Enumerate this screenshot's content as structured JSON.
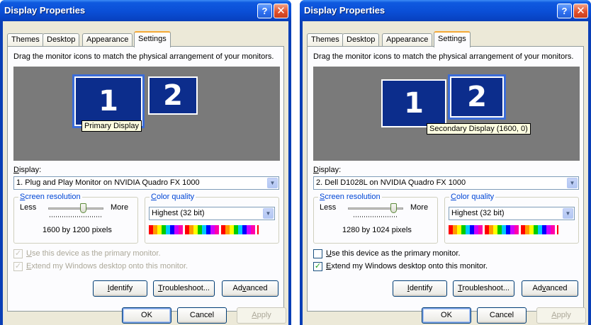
{
  "windows": [
    {
      "title": "Display Properties",
      "tabs": [
        "Themes",
        "Desktop",
        "Appearance",
        "Settings"
      ],
      "active_tab": "Settings",
      "instruction": "Drag the monitor icons to match the physical arrangement of your monitors.",
      "monitors": [
        {
          "number": "1",
          "selected": true
        },
        {
          "number": "2",
          "selected": false
        }
      ],
      "monitor_tooltip": "Primary Display",
      "display_label": "Display:",
      "display_value": "1. Plug and Play Monitor on NVIDIA Quadro FX 1000",
      "screen_resolution_label": "Screen resolution",
      "less_label": "Less",
      "more_label": "More",
      "resolution_value": "1600 by 1200 pixels",
      "color_quality_label": "Color quality",
      "color_quality_value": "Highest (32 bit)",
      "checkbox_primary": {
        "label": "Use this device as the primary monitor.",
        "checked": true,
        "disabled": true
      },
      "checkbox_extend": {
        "label": "Extend my Windows desktop onto this monitor.",
        "checked": true,
        "disabled": true
      },
      "buttons": {
        "identify": "Identify",
        "troubleshoot": "Troubleshoot...",
        "advanced": "Advanced"
      },
      "footer": {
        "ok": "OK",
        "cancel": "Cancel",
        "apply": "Apply"
      }
    },
    {
      "title": "Display Properties",
      "tabs": [
        "Themes",
        "Desktop",
        "Appearance",
        "Settings"
      ],
      "active_tab": "Settings",
      "instruction": "Drag the monitor icons to match the physical arrangement of your monitors.",
      "monitors": [
        {
          "number": "1",
          "selected": false
        },
        {
          "number": "2",
          "selected": true
        }
      ],
      "monitor_tooltip": "Secondary Display (1600, 0)",
      "display_label": "Display:",
      "display_value": "2. Dell D1028L on NVIDIA Quadro FX 1000",
      "screen_resolution_label": "Screen resolution",
      "less_label": "Less",
      "more_label": "More",
      "resolution_value": "1280 by 1024 pixels",
      "color_quality_label": "Color quality",
      "color_quality_value": "Highest (32 bit)",
      "checkbox_primary": {
        "label": "Use this device as the primary monitor.",
        "checked": false,
        "disabled": false
      },
      "checkbox_extend": {
        "label": "Extend my Windows desktop onto this monitor.",
        "checked": true,
        "disabled": false
      },
      "buttons": {
        "identify": "Identify",
        "troubleshoot": "Troubleshoot...",
        "advanced": "Advanced"
      },
      "footer": {
        "ok": "OK",
        "cancel": "Cancel",
        "apply": "Apply"
      }
    }
  ],
  "icons": {
    "help": "question-mark-icon",
    "close": "close-x-icon",
    "dropdown": "chevron-down-icon",
    "check": "checkmark-icon"
  },
  "colors": {
    "titlebar": "#0a4ed6",
    "client": "#ece9d8",
    "monitor_fill": "#0c2d8c",
    "monitor_area": "#7a7a7a",
    "tab_highlight": "#f5a936",
    "link_blue": "#0046d5"
  }
}
